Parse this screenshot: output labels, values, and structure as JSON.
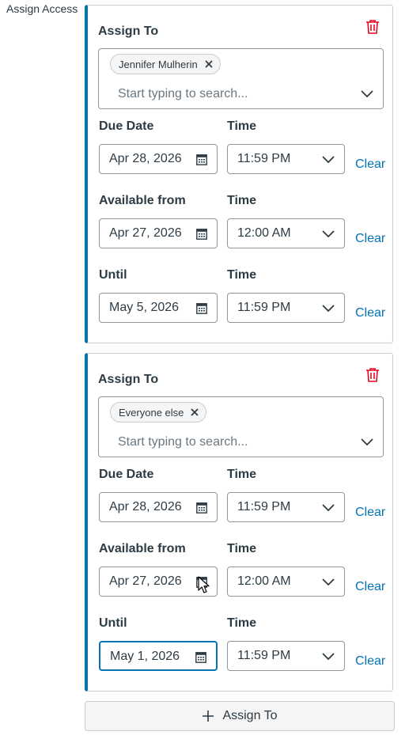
{
  "section_label": "Assign Access",
  "cards": [
    {
      "assign_label": "Assign To",
      "chip": "Jennifer Mulherin",
      "search_placeholder": "Start typing to search...",
      "rows": [
        {
          "label": "Due Date",
          "time_label": "Time",
          "date": "Apr 28, 2026",
          "time": "11:59 PM",
          "clear": "Clear"
        },
        {
          "label": "Available from",
          "time_label": "Time",
          "date": "Apr 27, 2026",
          "time": "12:00 AM",
          "clear": "Clear"
        },
        {
          "label": "Until",
          "time_label": "Time",
          "date": "May 5, 2026",
          "time": "11:59 PM",
          "clear": "Clear"
        }
      ]
    },
    {
      "assign_label": "Assign To",
      "chip": "Everyone else",
      "search_placeholder": "Start typing to search...",
      "rows": [
        {
          "label": "Due Date",
          "time_label": "Time",
          "date": "Apr 28, 2026",
          "time": "11:59 PM",
          "clear": "Clear"
        },
        {
          "label": "Available from",
          "time_label": "Time",
          "date": "Apr 27, 2026",
          "time": "12:00 AM",
          "clear": "Clear"
        },
        {
          "label": "Until",
          "time_label": "Time",
          "date": "May 1, 2026",
          "time": "11:59 PM",
          "clear": "Clear"
        }
      ]
    }
  ],
  "add_button": "Assign To",
  "colors": {
    "accent": "#0374b5",
    "danger": "#e0061f",
    "border": "#c7cdd1"
  },
  "icons": [
    "trash-icon",
    "close-icon",
    "chevron-down-icon",
    "calendar-icon",
    "plus-icon",
    "mouse-cursor-icon"
  ]
}
